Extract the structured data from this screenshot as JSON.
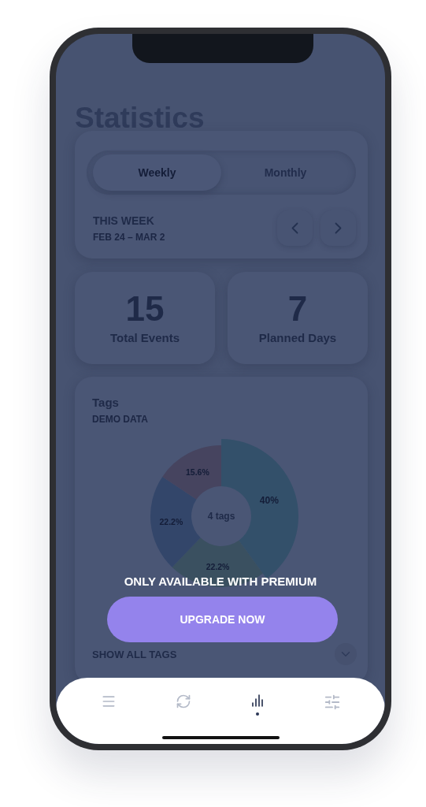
{
  "title": "Statistics",
  "period_tabs": [
    {
      "label": "Weekly",
      "selected": true
    },
    {
      "label": "Monthly",
      "selected": false
    }
  ],
  "period": {
    "label": "THIS WEEK",
    "range": "FEB 24 – MAR 2"
  },
  "stats": [
    {
      "value": "15",
      "label": "Total Events"
    },
    {
      "value": "7",
      "label": "Planned Days"
    }
  ],
  "tags_card": {
    "title": "Tags",
    "subtitle": "DEMO DATA",
    "center_label": "4 tags",
    "footer": "SHOW ALL TAGS",
    "slices": [
      {
        "color": "#33506a",
        "exploded": true
      },
      {
        "color": "#3a5060",
        "exploded": false
      },
      {
        "color": "#33466a",
        "exploded": false
      },
      {
        "color": "#46445f",
        "exploded": false
      }
    ],
    "chart_data": {
      "type": "donut",
      "values": [
        40,
        22.2,
        22.2,
        15.6
      ],
      "value_labels": [
        "40%",
        "22.2%",
        "22.2%",
        "15.6%"
      ]
    }
  },
  "premium": {
    "message": "ONLY AVAILABLE WITH PREMIUM",
    "button": "UPGRADE NOW"
  },
  "nav": [
    {
      "kind": "menu",
      "selected": false
    },
    {
      "kind": "sync",
      "selected": false
    },
    {
      "kind": "stats",
      "selected": true
    },
    {
      "kind": "settings",
      "selected": false
    }
  ]
}
